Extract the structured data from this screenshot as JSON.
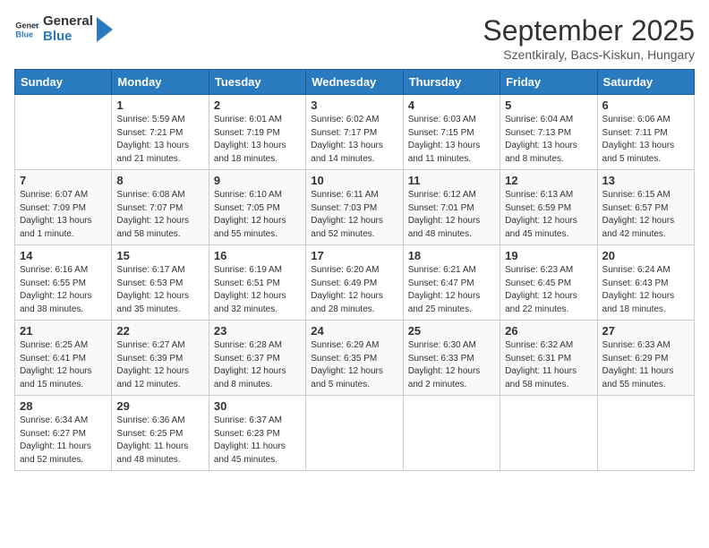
{
  "header": {
    "logo": {
      "text_general": "General",
      "text_blue": "Blue"
    },
    "title": "September 2025",
    "subtitle": "Szentkiraly, Bacs-Kiskun, Hungary"
  },
  "calendar": {
    "days_of_week": [
      "Sunday",
      "Monday",
      "Tuesday",
      "Wednesday",
      "Thursday",
      "Friday",
      "Saturday"
    ],
    "weeks": [
      [
        {
          "day": "",
          "sunrise": "",
          "sunset": "",
          "daylight": ""
        },
        {
          "day": "1",
          "sunrise": "Sunrise: 5:59 AM",
          "sunset": "Sunset: 7:21 PM",
          "daylight": "Daylight: 13 hours and 21 minutes."
        },
        {
          "day": "2",
          "sunrise": "Sunrise: 6:01 AM",
          "sunset": "Sunset: 7:19 PM",
          "daylight": "Daylight: 13 hours and 18 minutes."
        },
        {
          "day": "3",
          "sunrise": "Sunrise: 6:02 AM",
          "sunset": "Sunset: 7:17 PM",
          "daylight": "Daylight: 13 hours and 14 minutes."
        },
        {
          "day": "4",
          "sunrise": "Sunrise: 6:03 AM",
          "sunset": "Sunset: 7:15 PM",
          "daylight": "Daylight: 13 hours and 11 minutes."
        },
        {
          "day": "5",
          "sunrise": "Sunrise: 6:04 AM",
          "sunset": "Sunset: 7:13 PM",
          "daylight": "Daylight: 13 hours and 8 minutes."
        },
        {
          "day": "6",
          "sunrise": "Sunrise: 6:06 AM",
          "sunset": "Sunset: 7:11 PM",
          "daylight": "Daylight: 13 hours and 5 minutes."
        }
      ],
      [
        {
          "day": "7",
          "sunrise": "Sunrise: 6:07 AM",
          "sunset": "Sunset: 7:09 PM",
          "daylight": "Daylight: 13 hours and 1 minute."
        },
        {
          "day": "8",
          "sunrise": "Sunrise: 6:08 AM",
          "sunset": "Sunset: 7:07 PM",
          "daylight": "Daylight: 12 hours and 58 minutes."
        },
        {
          "day": "9",
          "sunrise": "Sunrise: 6:10 AM",
          "sunset": "Sunset: 7:05 PM",
          "daylight": "Daylight: 12 hours and 55 minutes."
        },
        {
          "day": "10",
          "sunrise": "Sunrise: 6:11 AM",
          "sunset": "Sunset: 7:03 PM",
          "daylight": "Daylight: 12 hours and 52 minutes."
        },
        {
          "day": "11",
          "sunrise": "Sunrise: 6:12 AM",
          "sunset": "Sunset: 7:01 PM",
          "daylight": "Daylight: 12 hours and 48 minutes."
        },
        {
          "day": "12",
          "sunrise": "Sunrise: 6:13 AM",
          "sunset": "Sunset: 6:59 PM",
          "daylight": "Daylight: 12 hours and 45 minutes."
        },
        {
          "day": "13",
          "sunrise": "Sunrise: 6:15 AM",
          "sunset": "Sunset: 6:57 PM",
          "daylight": "Daylight: 12 hours and 42 minutes."
        }
      ],
      [
        {
          "day": "14",
          "sunrise": "Sunrise: 6:16 AM",
          "sunset": "Sunset: 6:55 PM",
          "daylight": "Daylight: 12 hours and 38 minutes."
        },
        {
          "day": "15",
          "sunrise": "Sunrise: 6:17 AM",
          "sunset": "Sunset: 6:53 PM",
          "daylight": "Daylight: 12 hours and 35 minutes."
        },
        {
          "day": "16",
          "sunrise": "Sunrise: 6:19 AM",
          "sunset": "Sunset: 6:51 PM",
          "daylight": "Daylight: 12 hours and 32 minutes."
        },
        {
          "day": "17",
          "sunrise": "Sunrise: 6:20 AM",
          "sunset": "Sunset: 6:49 PM",
          "daylight": "Daylight: 12 hours and 28 minutes."
        },
        {
          "day": "18",
          "sunrise": "Sunrise: 6:21 AM",
          "sunset": "Sunset: 6:47 PM",
          "daylight": "Daylight: 12 hours and 25 minutes."
        },
        {
          "day": "19",
          "sunrise": "Sunrise: 6:23 AM",
          "sunset": "Sunset: 6:45 PM",
          "daylight": "Daylight: 12 hours and 22 minutes."
        },
        {
          "day": "20",
          "sunrise": "Sunrise: 6:24 AM",
          "sunset": "Sunset: 6:43 PM",
          "daylight": "Daylight: 12 hours and 18 minutes."
        }
      ],
      [
        {
          "day": "21",
          "sunrise": "Sunrise: 6:25 AM",
          "sunset": "Sunset: 6:41 PM",
          "daylight": "Daylight: 12 hours and 15 minutes."
        },
        {
          "day": "22",
          "sunrise": "Sunrise: 6:27 AM",
          "sunset": "Sunset: 6:39 PM",
          "daylight": "Daylight: 12 hours and 12 minutes."
        },
        {
          "day": "23",
          "sunrise": "Sunrise: 6:28 AM",
          "sunset": "Sunset: 6:37 PM",
          "daylight": "Daylight: 12 hours and 8 minutes."
        },
        {
          "day": "24",
          "sunrise": "Sunrise: 6:29 AM",
          "sunset": "Sunset: 6:35 PM",
          "daylight": "Daylight: 12 hours and 5 minutes."
        },
        {
          "day": "25",
          "sunrise": "Sunrise: 6:30 AM",
          "sunset": "Sunset: 6:33 PM",
          "daylight": "Daylight: 12 hours and 2 minutes."
        },
        {
          "day": "26",
          "sunrise": "Sunrise: 6:32 AM",
          "sunset": "Sunset: 6:31 PM",
          "daylight": "Daylight: 11 hours and 58 minutes."
        },
        {
          "day": "27",
          "sunrise": "Sunrise: 6:33 AM",
          "sunset": "Sunset: 6:29 PM",
          "daylight": "Daylight: 11 hours and 55 minutes."
        }
      ],
      [
        {
          "day": "28",
          "sunrise": "Sunrise: 6:34 AM",
          "sunset": "Sunset: 6:27 PM",
          "daylight": "Daylight: 11 hours and 52 minutes."
        },
        {
          "day": "29",
          "sunrise": "Sunrise: 6:36 AM",
          "sunset": "Sunset: 6:25 PM",
          "daylight": "Daylight: 11 hours and 48 minutes."
        },
        {
          "day": "30",
          "sunrise": "Sunrise: 6:37 AM",
          "sunset": "Sunset: 6:23 PM",
          "daylight": "Daylight: 11 hours and 45 minutes."
        },
        {
          "day": "",
          "sunrise": "",
          "sunset": "",
          "daylight": ""
        },
        {
          "day": "",
          "sunrise": "",
          "sunset": "",
          "daylight": ""
        },
        {
          "day": "",
          "sunrise": "",
          "sunset": "",
          "daylight": ""
        },
        {
          "day": "",
          "sunrise": "",
          "sunset": "",
          "daylight": ""
        }
      ]
    ]
  }
}
